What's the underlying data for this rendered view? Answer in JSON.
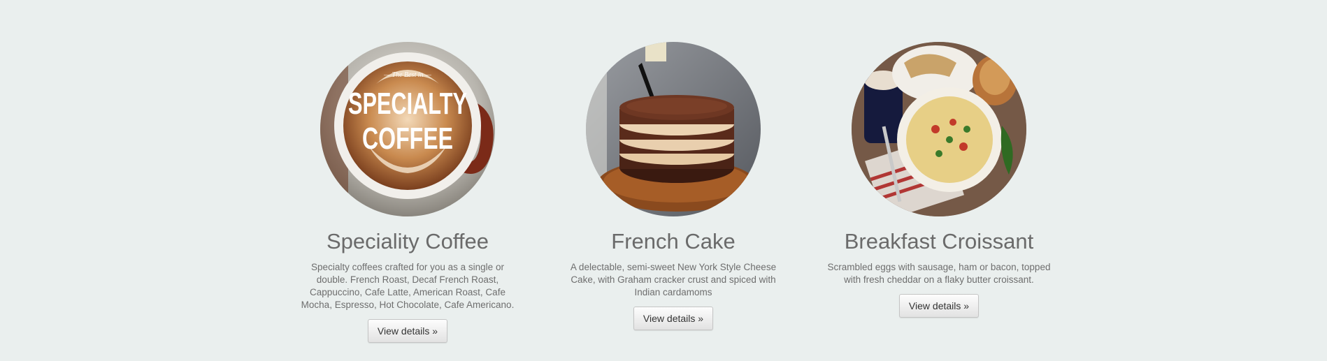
{
  "cards": [
    {
      "title": "Speciality Coffee",
      "description": "Specialty coffees crafted for you as a single or double. French Roast, Decaf French Roast, Cappuccino, Cafe Latte, American Roast, Cafe Mocha, Espresso, Hot Chocolate, Cafe Americano.",
      "button_label": "View details »",
      "image_text_line1": "SPECIALTY",
      "image_text_line2": "COFFEE",
      "image_text_small": "— The Best in — ",
      "image_icon": "coffee-cup-image"
    },
    {
      "title": "French Cake",
      "description": "A delectable, semi-sweet New York Style Cheese Cake, with Graham cracker crust and spiced with Indian cardamoms",
      "button_label": "View details »",
      "image_icon": "layer-cake-image"
    },
    {
      "title": "Breakfast Croissant",
      "description": "Scrambled eggs with sausage, ham or bacon, topped with fresh cheddar on a flaky butter croissant.",
      "button_label": "View details »",
      "image_icon": "breakfast-plate-image"
    }
  ],
  "colors": {
    "background": "#eaefee",
    "heading": "#6a6a6a",
    "body_text": "#6e6e6e"
  }
}
